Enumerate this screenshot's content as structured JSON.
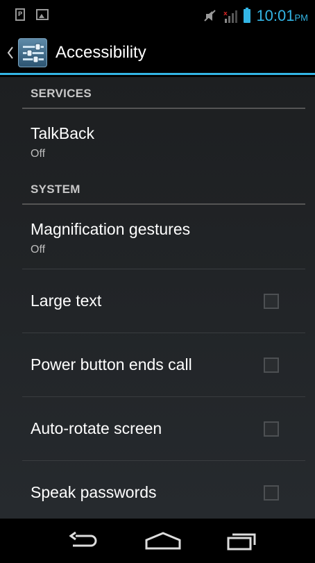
{
  "status_bar": {
    "left_icons": [
      "p-notification-icon",
      "image-notification-icon"
    ],
    "p_label": "P",
    "right_icons": [
      "mute-icon",
      "signal-icon",
      "battery-icon"
    ],
    "time": "10:01",
    "ampm": "PM",
    "accent": "#33b5e5"
  },
  "action_bar": {
    "title": "Accessibility",
    "icon": "settings-sliders-icon"
  },
  "sections": {
    "services": {
      "label": "SERVICES"
    },
    "system": {
      "label": "SYSTEM"
    }
  },
  "prefs": {
    "talkback": {
      "title": "TalkBack",
      "summary": "Off"
    },
    "magnification": {
      "title": "Magnification gestures",
      "summary": "Off"
    },
    "large_text": {
      "title": "Large text",
      "checked": false
    },
    "power_button": {
      "title": "Power button ends call",
      "checked": false
    },
    "auto_rotate": {
      "title": "Auto-rotate screen",
      "checked": false
    },
    "speak_passwords": {
      "title": "Speak passwords",
      "checked": false
    }
  },
  "nav_bar": {
    "buttons": [
      "back-icon",
      "home-icon",
      "recents-icon"
    ]
  }
}
